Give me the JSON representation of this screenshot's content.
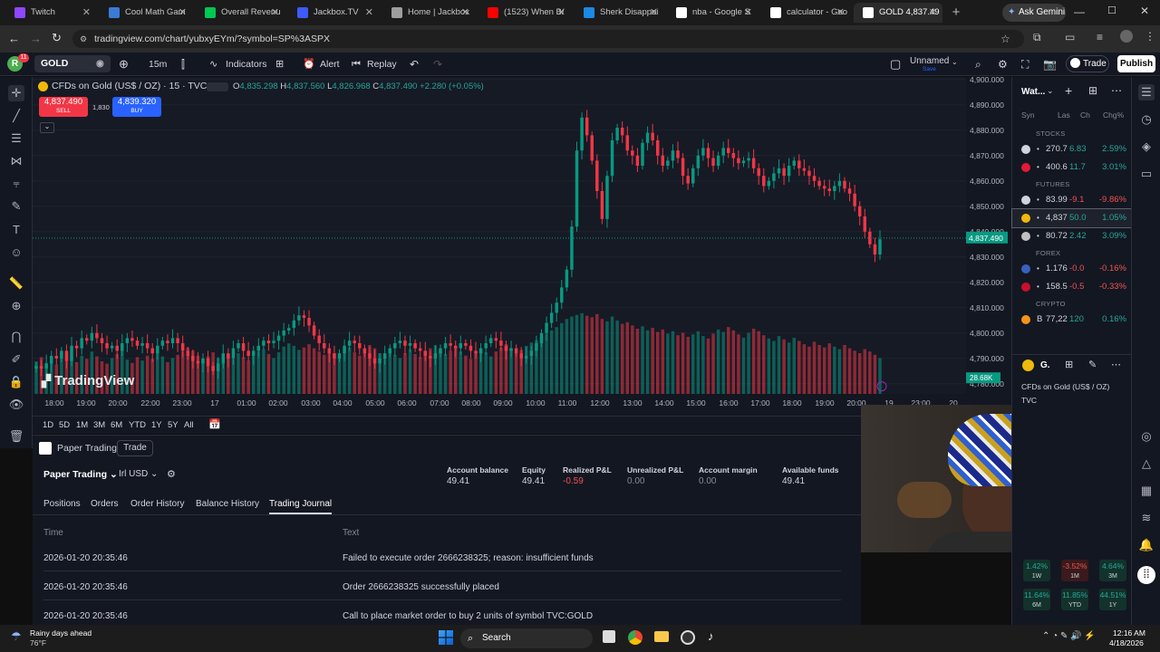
{
  "browser": {
    "tabs": [
      {
        "label": "Twitch",
        "color": "#9146ff"
      },
      {
        "label": "Cool Math Gam",
        "color": "#3b7bd6"
      },
      {
        "label": "Overall Revenu",
        "color": "#00c853"
      },
      {
        "label": "Jackbox.TV",
        "color": "#3d5afe"
      },
      {
        "label": "Home | Jackbox",
        "color": "#9e9e9e"
      },
      {
        "label": "(1523) When B/",
        "color": "#ff0000"
      },
      {
        "label": "Sherk Disappoi",
        "color": "#1e88e5"
      },
      {
        "label": "nba - Google S",
        "color": "#ffffff"
      },
      {
        "label": "calculator - Goo",
        "color": "#ffffff"
      },
      {
        "label": "GOLD 4,837.49",
        "color": "#ffffff"
      }
    ],
    "ask_gemini": "Ask Gemini",
    "url": "tradingview.com/chart/yubxyEYm/?symbol=SP%3ASPX"
  },
  "toolbar": {
    "avatar": "R",
    "badge": "11",
    "symbol": "GOLD",
    "interval": "15m",
    "indicators": "Indicators",
    "alert": "Alert",
    "replay": "Replay",
    "layout_name": "Unnamed",
    "layout_sub": "Save",
    "trade": "Trade",
    "publish": "Publish"
  },
  "legend": {
    "title": "CFDs on Gold (US$ / OZ) · 15 · TVC",
    "o_label": "O",
    "o": "4,835.298",
    "h_label": "H",
    "h": "4,837.560",
    "l_label": "L",
    "l": "4,826.968",
    "c_label": "C",
    "c": "4,837.490",
    "chg": "+2.280 (+0.05%)",
    "sell_price": "4,837.490",
    "sell": "SELL",
    "spread": "1,830",
    "buy_price": "4,839.320",
    "buy": "BUY"
  },
  "chart_data": {
    "type": "candlestick",
    "title": "CFDs on Gold (US$ / OZ) · 15 · TVC",
    "price_ticks": [
      "4,900.000",
      "4,890.000",
      "4,880.000",
      "4,870.000",
      "4,860.000",
      "4,850.000",
      "4,840.000",
      "4,830.000",
      "4,820.000",
      "4,810.000",
      "4,800.000",
      "4,790.000",
      "4,780.000"
    ],
    "time_ticks": [
      "18:00",
      "19:00",
      "20:00",
      "22:00",
      "23:00",
      "17",
      "01:00",
      "02:00",
      "03:00",
      "04:00",
      "05:00",
      "06:00",
      "07:00",
      "08:00",
      "09:00",
      "10:00",
      "11:00",
      "12:00",
      "13:00",
      "14:00",
      "15:00",
      "16:00",
      "17:00",
      "18:00",
      "19:00",
      "20:00",
      "19",
      "23:00",
      "20"
    ],
    "ylim": [
      4776,
      4901
    ],
    "current_price": "4,837.490",
    "volume_label": "28.68K",
    "closes": [
      4787,
      4786,
      4788,
      4791,
      4790,
      4793,
      4789,
      4795,
      4794,
      4798,
      4797,
      4800,
      4798,
      4796,
      4794,
      4795,
      4793,
      4796,
      4798,
      4797,
      4795,
      4796,
      4794,
      4792,
      4795,
      4797,
      4796,
      4798,
      4796,
      4793,
      4791,
      4789,
      4788,
      4790,
      4787,
      4785,
      4788,
      4792,
      4790,
      4794,
      4796,
      4793,
      4791,
      4793,
      4795,
      4797,
      4796,
      4797,
      4799,
      4801,
      4802,
      4805,
      4807,
      4806,
      4803,
      4799,
      4796,
      4794,
      4792,
      4790,
      4792,
      4795,
      4797,
      4796,
      4794,
      4792,
      4790,
      4788,
      4790,
      4792,
      4794,
      4796,
      4797,
      4795,
      4796,
      4794,
      4793,
      4791,
      4790,
      4792,
      4794,
      4796,
      4795,
      4794,
      4796,
      4795,
      4793,
      4792,
      4794,
      4796,
      4798,
      4797,
      4795,
      4793,
      4794,
      4792,
      4790,
      4791,
      4793,
      4796,
      4800,
      4804,
      4808,
      4812,
      4818,
      4825,
      4842,
      4872,
      4885,
      4878,
      4868,
      4856,
      4845,
      4862,
      4876,
      4881,
      4878,
      4872,
      4870,
      4866,
      4875,
      4879,
      4876,
      4870,
      4866,
      4868,
      4872,
      4869,
      4862,
      4859,
      4865,
      4870,
      4873,
      4869,
      4866,
      4870,
      4873,
      4871,
      4869,
      4867,
      4868,
      4869,
      4865,
      4862,
      4858,
      4860,
      4863,
      4865,
      4862,
      4866,
      4868,
      4865,
      4864,
      4862,
      4860,
      4858,
      4857,
      4856,
      4858,
      4860,
      4857,
      4855,
      4850,
      4846,
      4840,
      4835,
      4831,
      4837
    ],
    "volumes": [
      0.4,
      0.45,
      0.38,
      0.42,
      0.36,
      0.44,
      0.5,
      0.41,
      0.39,
      0.47,
      0.43,
      0.52,
      0.46,
      0.4,
      0.37,
      0.44,
      0.49,
      0.55,
      0.42,
      0.38,
      0.45,
      0.41,
      0.47,
      0.43,
      0.5,
      0.46,
      0.39,
      0.44,
      0.48,
      0.52,
      0.57,
      0.53,
      0.47,
      0.42,
      0.46,
      0.51,
      0.44,
      0.4,
      0.48,
      0.43,
      0.5,
      0.45,
      0.41,
      0.47,
      0.52,
      0.55,
      0.49,
      0.44,
      0.51,
      0.58,
      0.62,
      0.59,
      0.54,
      0.57,
      0.61,
      0.56,
      0.52,
      0.48,
      0.54,
      0.5,
      0.46,
      0.53,
      0.57,
      0.51,
      0.47,
      0.55,
      0.6,
      0.56,
      0.5,
      0.45,
      0.52,
      0.48,
      0.44,
      0.5,
      0.55,
      0.49,
      0.45,
      0.51,
      0.56,
      0.6,
      0.54,
      0.49,
      0.53,
      0.58,
      0.52,
      0.47,
      0.43,
      0.5,
      0.55,
      0.51,
      0.46,
      0.52,
      0.57,
      0.61,
      0.56,
      0.5,
      0.54,
      0.59,
      0.63,
      0.66,
      0.7,
      0.74,
      0.78,
      0.82,
      0.87,
      0.92,
      0.95,
      0.97,
      0.99,
      0.96,
      0.94,
      0.98,
      0.92,
      0.89,
      0.95,
      0.9,
      0.86,
      0.88,
      0.84,
      0.8,
      0.83,
      0.78,
      0.81,
      0.76,
      0.79,
      0.74,
      0.77,
      0.72,
      0.75,
      0.7,
      0.73,
      0.77,
      0.71,
      0.68,
      0.74,
      0.79,
      0.76,
      0.82,
      0.78,
      0.73,
      0.69,
      0.75,
      0.8,
      0.77,
      0.72,
      0.68,
      0.65,
      0.71,
      0.67,
      0.63,
      0.69,
      0.65,
      0.61,
      0.58,
      0.64,
      0.6,
      0.57,
      0.62,
      0.58,
      0.55,
      0.6,
      0.56,
      0.53,
      0.5,
      0.55,
      0.52,
      0.48,
      0.44,
      0.46,
      0.42,
      0.45,
      0.4,
      0.43
    ]
  },
  "watermark": "TradingView",
  "ranges": [
    "1D",
    "5D",
    "1M",
    "3M",
    "6M",
    "YTD",
    "1Y",
    "5Y",
    "All"
  ],
  "paper": {
    "title": "Paper Trading",
    "trade_btn": "Trade",
    "account": "Paper Trading",
    "currency": "Irl USD",
    "stats": [
      {
        "label": "Account balance",
        "value": "49.41",
        "neg": false
      },
      {
        "label": "Equity",
        "value": "49.41",
        "neg": false
      },
      {
        "label": "Realized P&L",
        "value": "-0.59",
        "neg": true
      },
      {
        "label": "Unrealized P&L",
        "value": "0.00",
        "neg": false
      },
      {
        "label": "Account margin",
        "value": "0.00",
        "neg": false
      },
      {
        "label": "Available funds",
        "value": "49.41",
        "neg": false
      }
    ],
    "tabs": [
      "Positions",
      "Orders",
      "Order History",
      "Balance History",
      "Trading Journal"
    ],
    "col_time": "Time",
    "col_text": "Text",
    "rows": [
      {
        "time": "2026-01-20 20:35:46",
        "text": "Failed to execute order 2666238325; reason: insufficient funds"
      },
      {
        "time": "2026-01-20 20:35:46",
        "text": "Order 2666238325 successfully placed"
      },
      {
        "time": "2026-01-20 20:35:46",
        "text": "Call to place market order to buy 2 units of symbol TVC:GOLD"
      }
    ]
  },
  "watchlist": {
    "title": "Wat...",
    "cols": [
      "Syn",
      "Las",
      "Ch",
      "Chg%"
    ],
    "sections": [
      {
        "name": "STOCKS",
        "items": [
          {
            "sym": "",
            "last": "270.7",
            "ch": "6.83",
            "chp": "2.59%",
            "up": true,
            "color": "#d1d4dc"
          },
          {
            "sym": "",
            "last": "400.6",
            "ch": "11.7",
            "chp": "3.01%",
            "up": true,
            "color": "#e31937"
          }
        ]
      },
      {
        "name": "FUTURES",
        "items": [
          {
            "sym": "",
            "last": "83.99",
            "ch": "-9.1",
            "chp": "-9.86%",
            "up": false,
            "color": "#d1d4dc"
          },
          {
            "sym": "",
            "last": "4,837",
            "ch": "50.0",
            "chp": "1.05%",
            "up": true,
            "color": "#f0b90b"
          },
          {
            "sym": "",
            "last": "80.72",
            "ch": "2.42",
            "chp": "3.09%",
            "up": true,
            "color": "#c0c0c0"
          }
        ]
      },
      {
        "name": "FOREX",
        "items": [
          {
            "sym": "",
            "last": "1.176",
            "ch": "-0.0",
            "chp": "-0.16%",
            "up": false,
            "color": "#3b5fc0"
          },
          {
            "sym": "",
            "last": "158.5",
            "ch": "-0.5",
            "chp": "-0.33%",
            "up": false,
            "color": "#c8102e"
          }
        ]
      },
      {
        "name": "CRYPTO",
        "items": [
          {
            "sym": "B",
            "last": "77,22",
            "ch": "120",
            "chp": "0.16%",
            "up": true,
            "color": "#f7931a"
          }
        ]
      }
    ],
    "detail_sym": "G.",
    "detail_name": "CFDs on Gold (US$ / OZ)",
    "detail_src": "TVC",
    "perf": [
      {
        "v": "1.42%",
        "l": "1W",
        "up": true
      },
      {
        "v": "-3.52%",
        "l": "1M",
        "up": false
      },
      {
        "v": "4.64%",
        "l": "3M",
        "up": true
      },
      {
        "v": "11.64%",
        "l": "6M",
        "up": true
      },
      {
        "v": "11.85%",
        "l": "YTD",
        "up": true
      },
      {
        "v": "44.51%",
        "l": "1Y",
        "up": true
      }
    ]
  },
  "taskbar": {
    "weather": "Rainy days ahead",
    "temp": "76°F",
    "search": "Search",
    "time": "12:16 AM",
    "date": "4/18/2026"
  }
}
